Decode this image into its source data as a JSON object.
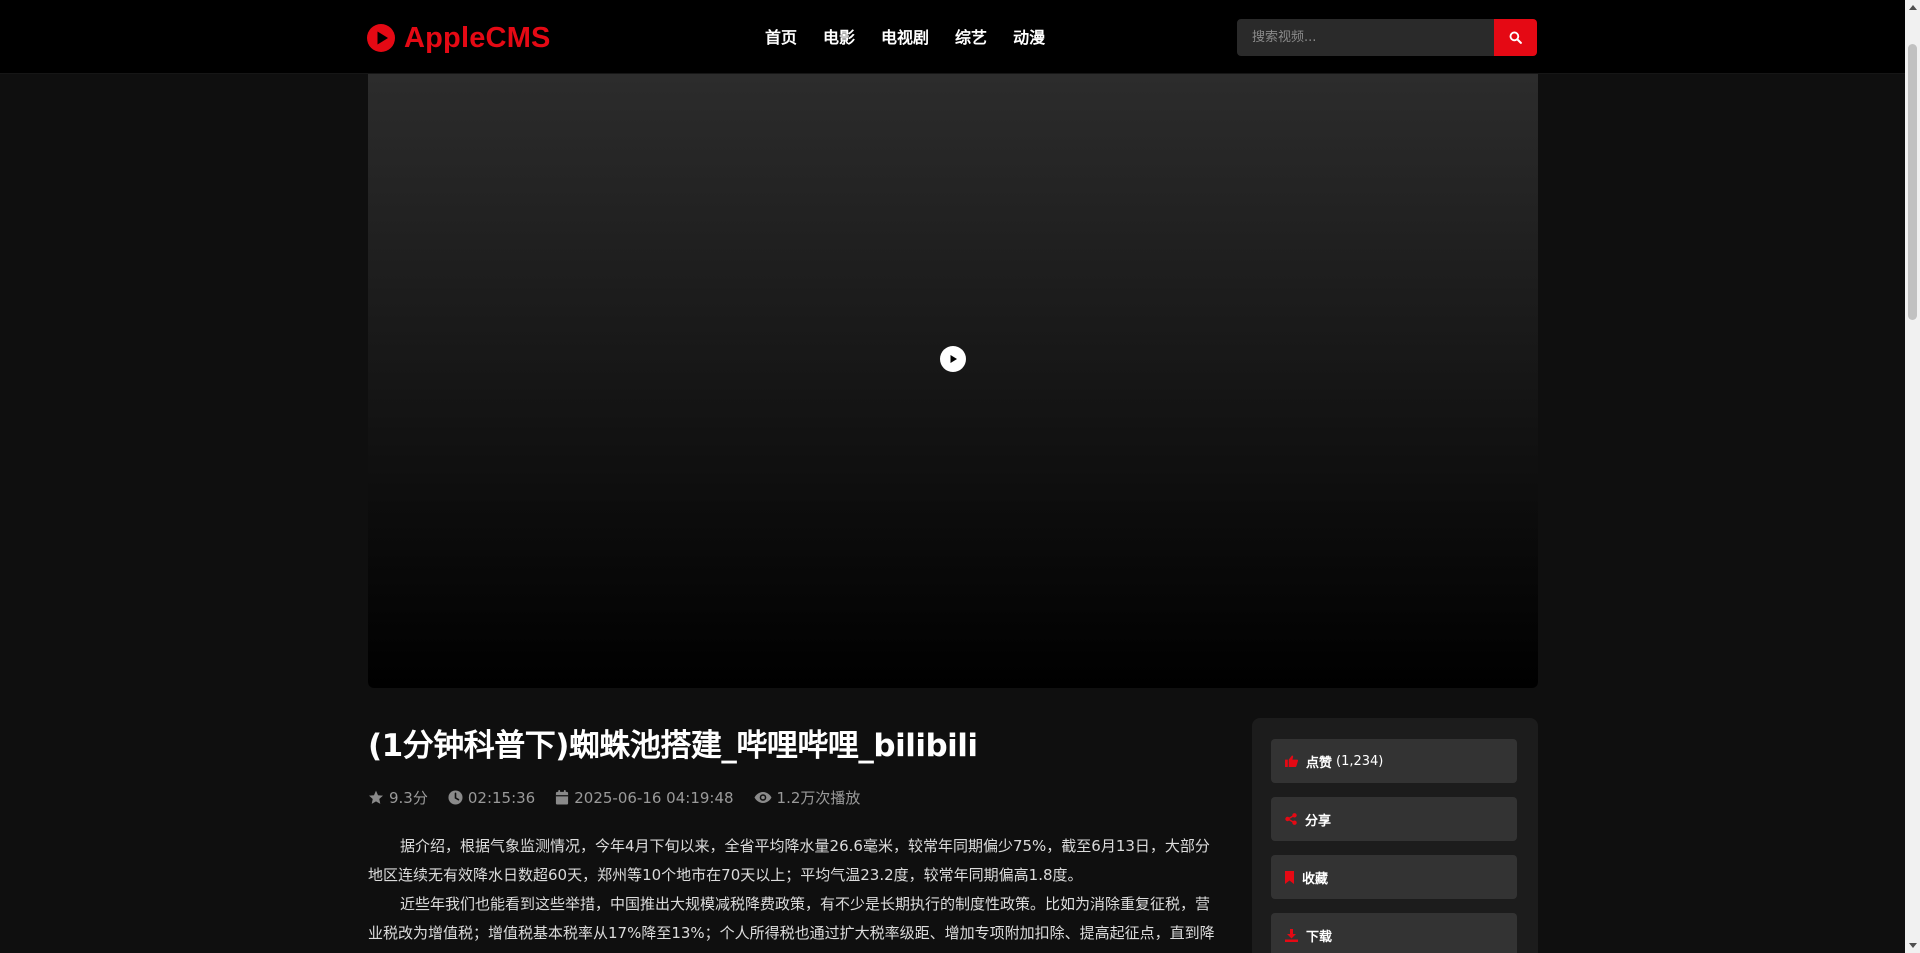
{
  "header": {
    "logo_text": "AppleCMS",
    "nav": [
      "首页",
      "电影",
      "电视剧",
      "综艺",
      "动漫"
    ],
    "search_placeholder": "搜索视频..."
  },
  "video": {
    "title": "(1分钟科普下)蜘蛛池搭建_哔哩哔哩_bilibili",
    "rating": "9.3分",
    "duration": "02:15:36",
    "date": "2025-06-16 04:19:48",
    "views": "1.2万次播放"
  },
  "description": [
    "据介绍，根据气象监测情况，今年4月下旬以来，全省平均降水量26.6毫米，较常年同期偏少75%，截至6月13日，大部分地区连续无有效降水日数超60天，郑州等10个地市在70天以上；平均气温23.2度，较常年同期偏高1.8度。",
    "近些年我们也能看到这些举措，中国推出大规模减税降费政策，有不少是长期执行的制度性政策。比如为消除重复征税，营业税改为增值税；增值税基本税率从17%降至13%；个人所得税也通过扩大税率级距、增加专项附加扣除、提高起征点，直到降低税负，减轻压力，扶持的行业和群体也越来越广泛。"
  ],
  "actions": {
    "like_label": "点赞",
    "like_count": "(1,234)",
    "share_label": "分享",
    "favorite_label": "收藏",
    "download_label": "下载"
  },
  "colors": {
    "accent": "#e50914",
    "background": "#0f0f0f",
    "header": "#000000"
  }
}
